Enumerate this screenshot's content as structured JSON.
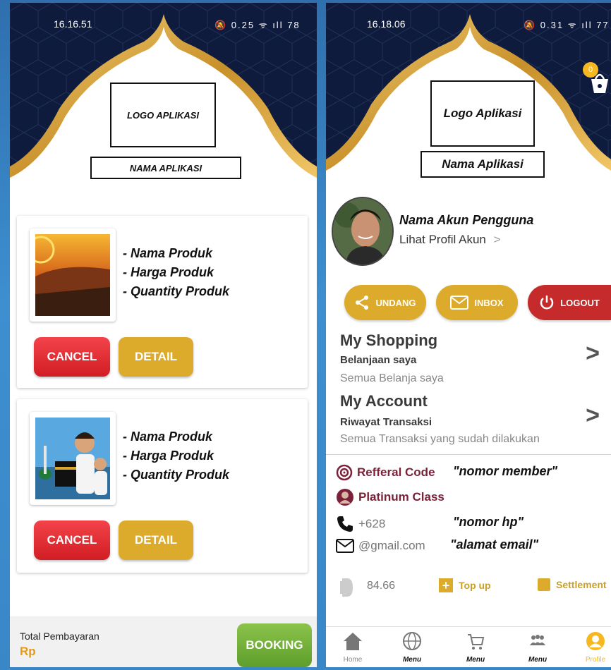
{
  "left": {
    "status": {
      "time": "16.16.51",
      "right": "🔕 0.25 ᯤ ıll 78"
    },
    "logo_text": "LOGO APLIKASI",
    "app_name_text": "NAMA APLIKASI",
    "products": [
      {
        "lines": [
          "- Nama Produk",
          "- Harga Produk",
          "- Quantity Produk"
        ],
        "cancel": "CANCEL",
        "detail": "DETAIL"
      },
      {
        "lines": [
          "- Nama Produk",
          "- Harga Produk",
          "- Quantity Produk"
        ],
        "cancel": "CANCEL",
        "detail": "DETAIL"
      }
    ],
    "footer": {
      "label": "Total Pembayaran",
      "currency": "Rp",
      "booking": "BOOKING"
    }
  },
  "right": {
    "status": {
      "time": "16.18.06",
      "right": "🔕 0.31 ᯤ ıll 77"
    },
    "cart_badge": "0",
    "logo_text": "Logo Aplikasi",
    "app_name_text": "Nama Aplikasi",
    "user": {
      "name": "Nama Akun Pengguna",
      "link": "Lihat Profil Akun",
      "link_chevron": ">"
    },
    "actions": {
      "invite": "UNDANG",
      "inbox": "INBOX",
      "logout": "LOGOUT"
    },
    "shopping": {
      "title": "My Shopping",
      "subtitle": "Belanjaan saya",
      "desc": "Semua Belanja saya",
      "chevron": ">"
    },
    "account": {
      "title": "My Account",
      "subtitle": "Riwayat Transaksi",
      "desc": "Semua Transaksi yang sudah dilakukan",
      "chevron": ">"
    },
    "info": {
      "referral_label": "Refferal Code",
      "referral_value": "\"nomor member\"",
      "class_label": "Platinum Class",
      "phone": "+628",
      "phone_value": "\"nomor hp\"",
      "email": "@gmail.com",
      "email_value": "\"alamat email\""
    },
    "balance": {
      "amount": "84.66",
      "topup": "Top up",
      "settlement": "Settlement"
    },
    "nav": [
      {
        "label": "Home"
      },
      {
        "label": "Menu"
      },
      {
        "label": "Menu"
      },
      {
        "label": "Menu"
      },
      {
        "label": "Profile"
      }
    ],
    "colors": {
      "gold": "#dcab2c",
      "maroon": "#7b2139",
      "red": "#c62b2b"
    }
  }
}
